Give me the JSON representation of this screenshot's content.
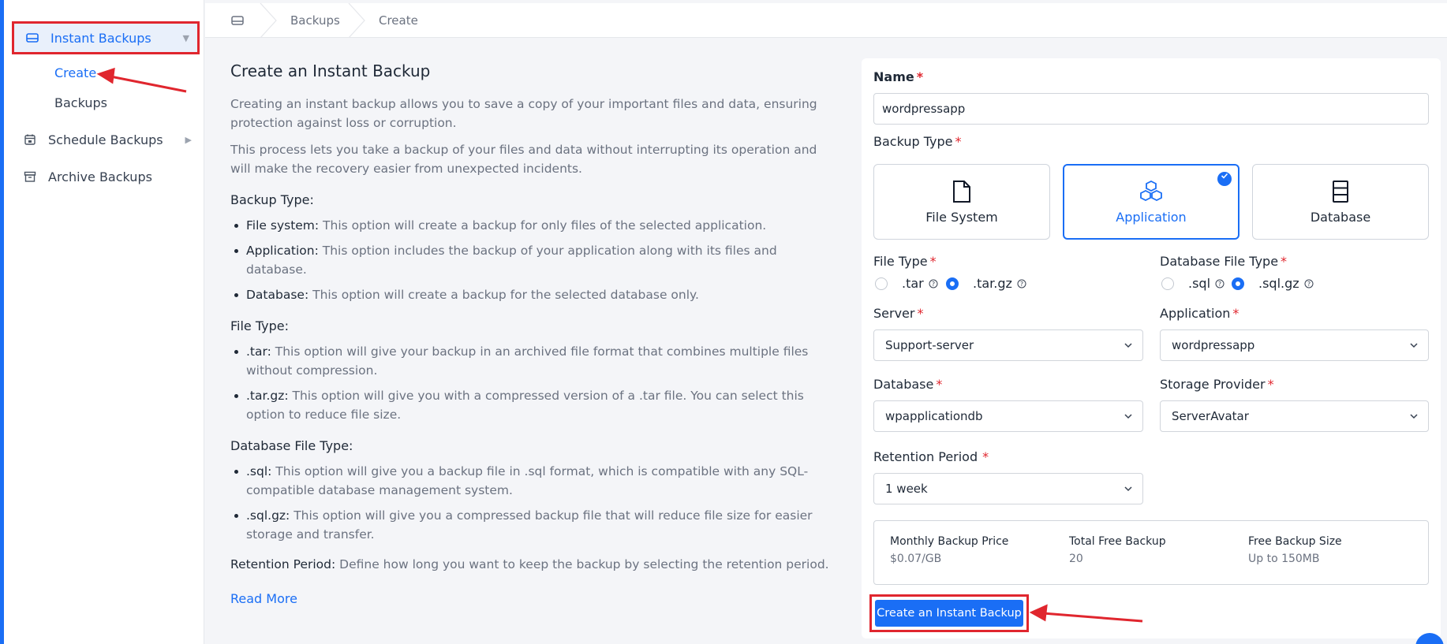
{
  "sidebar": {
    "instant_backups": "Instant Backups",
    "create": "Create",
    "backups": "Backups",
    "schedule_backups": "Schedule Backups",
    "archive_backups": "Archive Backups"
  },
  "breadcrumb": {
    "items": [
      "Backups",
      "Create"
    ]
  },
  "info": {
    "title": "Create an Instant Backup",
    "intro1": "Creating an instant backup allows you to save a copy of your important files and data, ensuring protection against loss or corruption.",
    "intro2": "This process lets you take a backup of your files and data without interrupting its operation and will make the recovery easier from unexpected incidents.",
    "backup_type": {
      "heading": "Backup Type:",
      "items": [
        {
          "term": "File system:",
          "desc": " This option will create a backup for only files of the selected application."
        },
        {
          "term": "Application:",
          "desc": " This option includes the backup of your application along with its files and database."
        },
        {
          "term": "Database:",
          "desc": " This option will create a backup for the selected database only."
        }
      ]
    },
    "file_type": {
      "heading": "File Type:",
      "items": [
        {
          "term": ".tar:",
          "desc": " This option will give your backup in an archived file format that combines multiple files without compression."
        },
        {
          "term": ".tar.gz:",
          "desc": " This option will give you with a compressed version of a .tar file. You can select this option to reduce file size."
        }
      ]
    },
    "db_file_type": {
      "heading": "Database File Type:",
      "items": [
        {
          "term": ".sql:",
          "desc": " This option will give you a backup file in .sql format, which is compatible with any SQL-compatible database management system."
        },
        {
          "term": ".sql.gz:",
          "desc": " This option will give you a compressed backup file that will reduce file size for easier storage and transfer."
        }
      ]
    },
    "retention": {
      "term": "Retention Period:",
      "desc": " Define how long you want to keep the backup by selecting the retention period."
    },
    "read_more": "Read More"
  },
  "form": {
    "name_label": "Name",
    "name_value": "wordpressapp",
    "backup_type_label": "Backup Type",
    "types": [
      "File System",
      "Application",
      "Database"
    ],
    "file_type_label": "File Type",
    "file_types": [
      ".tar",
      ".tar.gz"
    ],
    "db_file_type_label": "Database File Type",
    "db_file_types": [
      ".sql",
      ".sql.gz"
    ],
    "server_label": "Server",
    "server_value": "Support-server",
    "application_label": "Application",
    "application_value": "wordpressapp",
    "database_label": "Database",
    "database_value": "wpapplicationdb",
    "storage_label": "Storage Provider",
    "storage_value": "ServerAvatar",
    "retention_label": "Retention Period",
    "retention_value": "1 week",
    "required_mark": "*",
    "summary": {
      "price_label": "Monthly Backup Price",
      "price_value": "$0.07/GB",
      "free_label": "Total Free Backup",
      "free_value": "20",
      "size_label": "Free Backup Size",
      "size_value": "Up to 150MB"
    },
    "submit": "Create an Instant Backup"
  },
  "colors": {
    "accent": "#1a6ef5",
    "highlight": "#e0262e"
  }
}
